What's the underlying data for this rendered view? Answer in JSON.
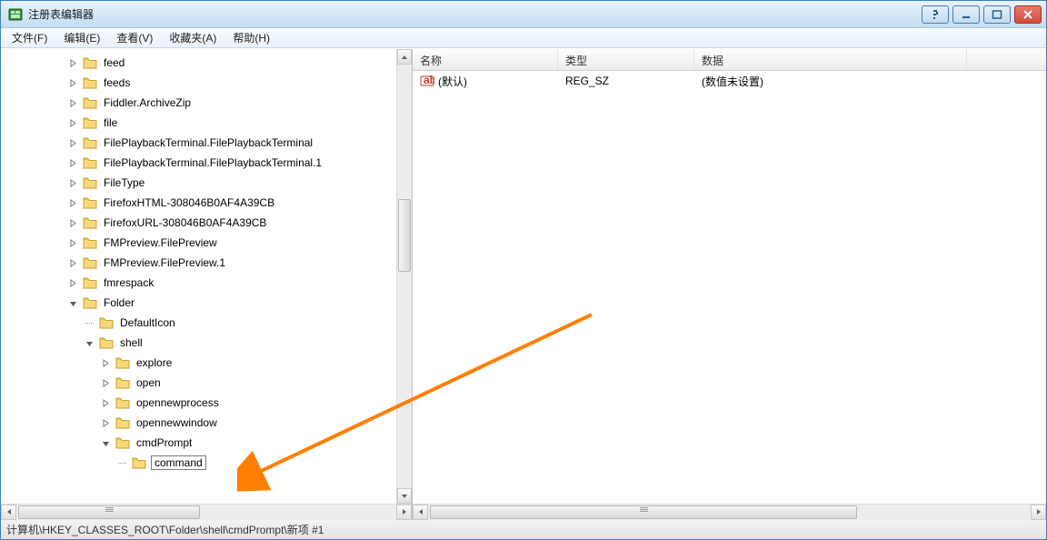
{
  "window": {
    "title": "注册表编辑器"
  },
  "menubar": [
    "文件(F)",
    "编辑(E)",
    "查看(V)",
    "收藏夹(A)",
    "帮助(H)"
  ],
  "tree": [
    {
      "depth": 3,
      "exp": "closed",
      "label": "feed"
    },
    {
      "depth": 3,
      "exp": "closed",
      "label": "feeds"
    },
    {
      "depth": 3,
      "exp": "closed",
      "label": "Fiddler.ArchiveZip"
    },
    {
      "depth": 3,
      "exp": "closed",
      "label": "file"
    },
    {
      "depth": 3,
      "exp": "closed",
      "label": "FilePlaybackTerminal.FilePlaybackTerminal"
    },
    {
      "depth": 3,
      "exp": "closed",
      "label": "FilePlaybackTerminal.FilePlaybackTerminal.1"
    },
    {
      "depth": 3,
      "exp": "closed",
      "label": "FileType"
    },
    {
      "depth": 3,
      "exp": "closed",
      "label": "FirefoxHTML-308046B0AF4A39CB"
    },
    {
      "depth": 3,
      "exp": "closed",
      "label": "FirefoxURL-308046B0AF4A39CB"
    },
    {
      "depth": 3,
      "exp": "closed",
      "label": "FMPreview.FilePreview"
    },
    {
      "depth": 3,
      "exp": "closed",
      "label": "FMPreview.FilePreview.1"
    },
    {
      "depth": 3,
      "exp": "closed",
      "label": "fmrespack"
    },
    {
      "depth": 3,
      "exp": "open",
      "label": "Folder"
    },
    {
      "depth": 4,
      "exp": "none",
      "label": "DefaultIcon"
    },
    {
      "depth": 4,
      "exp": "open",
      "label": "shell"
    },
    {
      "depth": 5,
      "exp": "closed",
      "label": "explore"
    },
    {
      "depth": 5,
      "exp": "closed",
      "label": "open"
    },
    {
      "depth": 5,
      "exp": "closed",
      "label": "opennewprocess"
    },
    {
      "depth": 5,
      "exp": "closed",
      "label": "opennewwindow"
    },
    {
      "depth": 5,
      "exp": "open",
      "label": "cmdPrompt"
    },
    {
      "depth": 6,
      "exp": "none",
      "label": "command",
      "editing": true
    }
  ],
  "list": {
    "columns": {
      "name": "名称",
      "type": "类型",
      "data": "数据"
    },
    "col_widths": {
      "name": 160,
      "type": 150,
      "data": 300
    },
    "rows": [
      {
        "name": "(默认)",
        "type": "REG_SZ",
        "data": "(数值未设置)"
      }
    ]
  },
  "statusbar": "计算机\\HKEY_CLASSES_ROOT\\Folder\\shell\\cmdPrompt\\新项 #1"
}
